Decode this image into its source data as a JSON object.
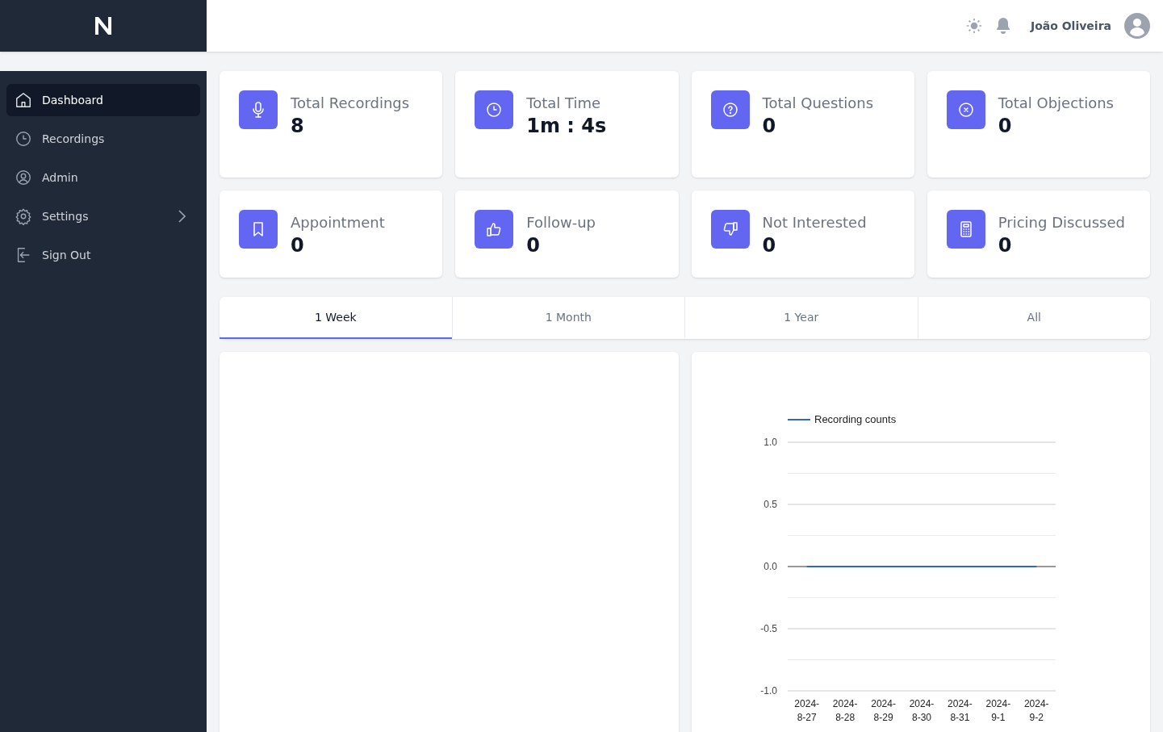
{
  "header": {
    "user_name": "João Oliveira"
  },
  "sidebar": {
    "items": [
      {
        "label": "Dashboard",
        "selected": true,
        "has_submenu": false
      },
      {
        "label": "Recordings",
        "selected": false,
        "has_submenu": false
      },
      {
        "label": "Admin",
        "selected": false,
        "has_submenu": false
      },
      {
        "label": "Settings",
        "selected": false,
        "has_submenu": true
      },
      {
        "label": "Sign Out",
        "selected": false,
        "has_submenu": false
      }
    ]
  },
  "stats": [
    {
      "label": "Total Recordings",
      "value": "8"
    },
    {
      "label": "Total Time",
      "value": "1m : 4s"
    },
    {
      "label": "Total Questions",
      "value": "0"
    },
    {
      "label": "Total Objections",
      "value": "0"
    },
    {
      "label": "Appointment",
      "value": "0"
    },
    {
      "label": "Follow-up",
      "value": "0"
    },
    {
      "label": "Not Interested",
      "value": "0"
    },
    {
      "label": "Pricing Discussed",
      "value": "0"
    }
  ],
  "period_tabs": [
    {
      "label": "1 Week",
      "selected": true
    },
    {
      "label": "1 Month",
      "selected": false
    },
    {
      "label": "1 Year",
      "selected": false
    },
    {
      "label": "All",
      "selected": false
    }
  ],
  "chart_data": {
    "type": "line",
    "categories": [
      "2024-8-27",
      "2024-8-28",
      "2024-8-29",
      "2024-8-30",
      "2024-8-31",
      "2024-9-1",
      "2024-9-2"
    ],
    "series": [
      {
        "name": "Recording counts",
        "color": "#3366cc",
        "values": [
          0,
          0,
          0,
          0,
          0,
          0,
          0
        ]
      }
    ],
    "ylim": [
      -1,
      1
    ],
    "yticks": [
      {
        "value": 1,
        "label": "1.0"
      },
      {
        "value": 0.5,
        "label": "0.5"
      },
      {
        "value": 0,
        "label": "0.0"
      },
      {
        "value": -0.5,
        "label": "-0.5"
      },
      {
        "value": -1,
        "label": "-1.0"
      }
    ]
  }
}
